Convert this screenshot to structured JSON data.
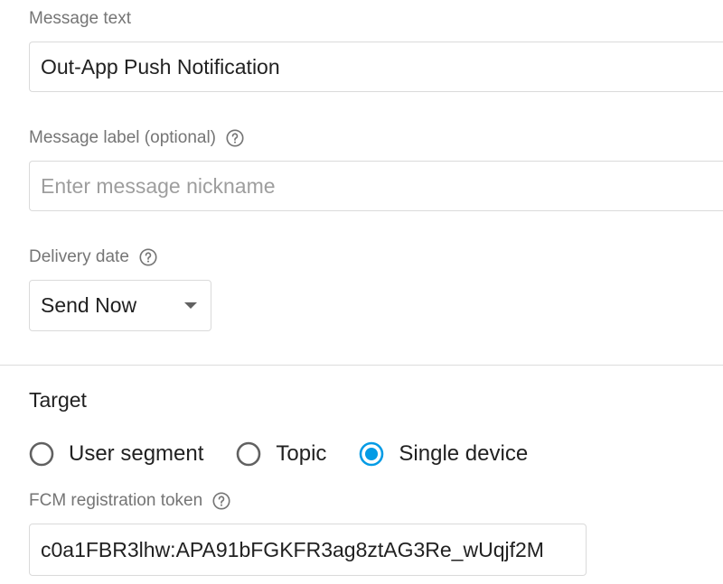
{
  "message_text": {
    "label": "Message text",
    "value": "Out-App Push Notification"
  },
  "message_label": {
    "label": "Message label (optional)",
    "placeholder": "Enter message nickname",
    "help_icon": "help-circle-icon"
  },
  "delivery_date": {
    "label": "Delivery date",
    "selected": "Send Now",
    "help_icon": "help-circle-icon"
  },
  "target": {
    "title": "Target",
    "options": [
      {
        "label": "User segment",
        "selected": false
      },
      {
        "label": "Topic",
        "selected": false
      },
      {
        "label": "Single device",
        "selected": true
      }
    ]
  },
  "fcm_token": {
    "label": "FCM registration token",
    "value": "c0a1FBR3lhw:APA91bFGKFR3ag8ztAG3Re_wUqjf2M",
    "help_icon": "help-circle-icon"
  },
  "colors": {
    "label_text": "#757575",
    "body_text": "#212121",
    "border": "#dadada",
    "radio_selected": "#039be5",
    "radio_unselected": "#616161"
  }
}
